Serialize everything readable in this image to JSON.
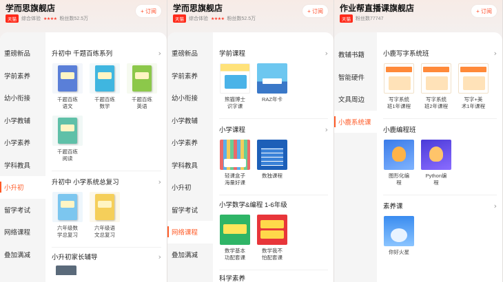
{
  "screens": [
    {
      "store": {
        "name": "学而思旗舰店",
        "badge": "天猫",
        "rating_label": "综合体验",
        "stars": "★★★★",
        "fans": "粉丝数52.5万",
        "subscribe": "+ 订阅"
      },
      "sidebar": [
        "重磅新品",
        "学前素养",
        "幼小衔接",
        "小学教辅",
        "小学素养",
        "学科教具",
        "小升初",
        "留学考试",
        "网络课程",
        "叠加满减"
      ],
      "active_index": 6,
      "sections": [
        {
          "title": "升初中 千题百练系列",
          "products": [
            "千题百练\n语文",
            "千题百练\n数学",
            "千题百练\n英语",
            "千题百练\n阅读"
          ]
        },
        {
          "title": "升初中 小学系统总复习",
          "products": [
            "六年级数\n学总复习",
            "六年级语\n文总复习"
          ]
        },
        {
          "title": "小升初家长辅导",
          "products": []
        }
      ]
    },
    {
      "store": {
        "name": "学而思旗舰店",
        "badge": "天猫",
        "rating_label": "综合体验",
        "stars": "★★★★",
        "fans": "粉丝数52.5万",
        "subscribe": "+ 订阅"
      },
      "sidebar": [
        "重磅新品",
        "学前素养",
        "幼小衔接",
        "小学教辅",
        "小学素养",
        "学科教具",
        "小升初",
        "留学考试",
        "网络课程",
        "叠加满减"
      ],
      "active_index": 8,
      "sections": [
        {
          "title": "学前课程",
          "products": [
            "熊猫博士\n识字课",
            "RAZ年卡"
          ]
        },
        {
          "title": "小学课程",
          "products": [
            "轻课盒子\n海量好课",
            "数独课程"
          ]
        },
        {
          "title": "小学数学&编程 1-6年级",
          "products": [
            "数学基本\n功配套课",
            "数学我不\n怕配套课"
          ]
        },
        {
          "title": "科学素养",
          "products": []
        }
      ]
    },
    {
      "store": {
        "name": "作业帮直播课旗舰店",
        "badge": "天猫",
        "fans": "粉丝数77747",
        "subscribe": "+ 订阅"
      },
      "sidebar": [
        "教辅书籍",
        "智能硬件",
        "文具周边",
        "小鹿系统课"
      ],
      "active_index": 3,
      "sections": [
        {
          "title": "小鹿写字系统班",
          "products": [
            "写字系统\n班1年课程",
            "写字系统\n班2年课程",
            "写字+美\n术1年课程"
          ]
        },
        {
          "title": "小鹿编程班",
          "products": [
            "图形化编\n程",
            "Python编\n程"
          ]
        },
        {
          "title": "素养课",
          "products": [
            "你好火星"
          ]
        }
      ]
    }
  ]
}
